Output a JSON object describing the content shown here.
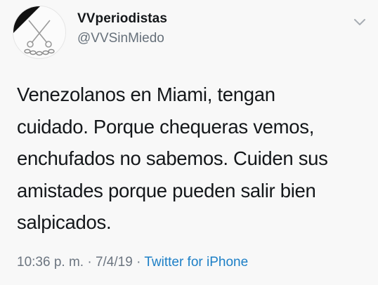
{
  "tweet": {
    "display_name": "VVperiodistas",
    "handle": "@VVSinMiedo",
    "text_lines": [
      "Venezolanos en Miami, tengan",
      "cuidado. Porque chequeras vemos,",
      "enchufados no sabemos. Cuiden sus",
      "amistades porque pueden salir bien",
      "salpicados."
    ],
    "time": "10:36 p. m.",
    "separator": "·",
    "date": "7/4/19",
    "source": "Twitter for iPhone"
  },
  "icons": {
    "avatar": "black-ribbon-scissors-chain-logo",
    "menu": "chevron-down-icon"
  },
  "colors": {
    "text": "#14171a",
    "secondary": "#66707a",
    "link": "#1d7fc6",
    "background": "#f8f8f8"
  }
}
